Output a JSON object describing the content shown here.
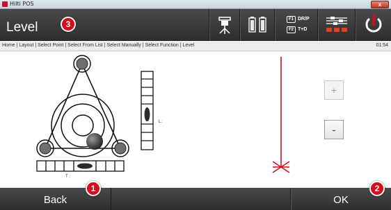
{
  "window": {
    "title": "Hilti POS",
    "close_glyph": "x"
  },
  "header": {
    "title": "Level",
    "callout": "3",
    "tools": [
      {
        "name": "instrument-icon"
      },
      {
        "name": "battery-icon"
      },
      {
        "name": "face-keys",
        "f1": "F1",
        "f1_label": "DR/P",
        "f2": "F2",
        "f2_label": "T+D"
      },
      {
        "name": "settings-sliders-icon"
      },
      {
        "name": "power-icon"
      }
    ],
    "accent": "#d90a1a"
  },
  "breadcrumb": {
    "text": "Home | Layout | Select Point | Select From List | Select Manually | Select Function | Level",
    "time": "01:54"
  },
  "level_view": {
    "vertical_label": "L:",
    "horizontal_label": "T :",
    "plus_label": "+",
    "minus_label": "-"
  },
  "footer": {
    "back_label": "Back",
    "back_callout": "1",
    "ok_label": "OK",
    "ok_callout": "2"
  }
}
